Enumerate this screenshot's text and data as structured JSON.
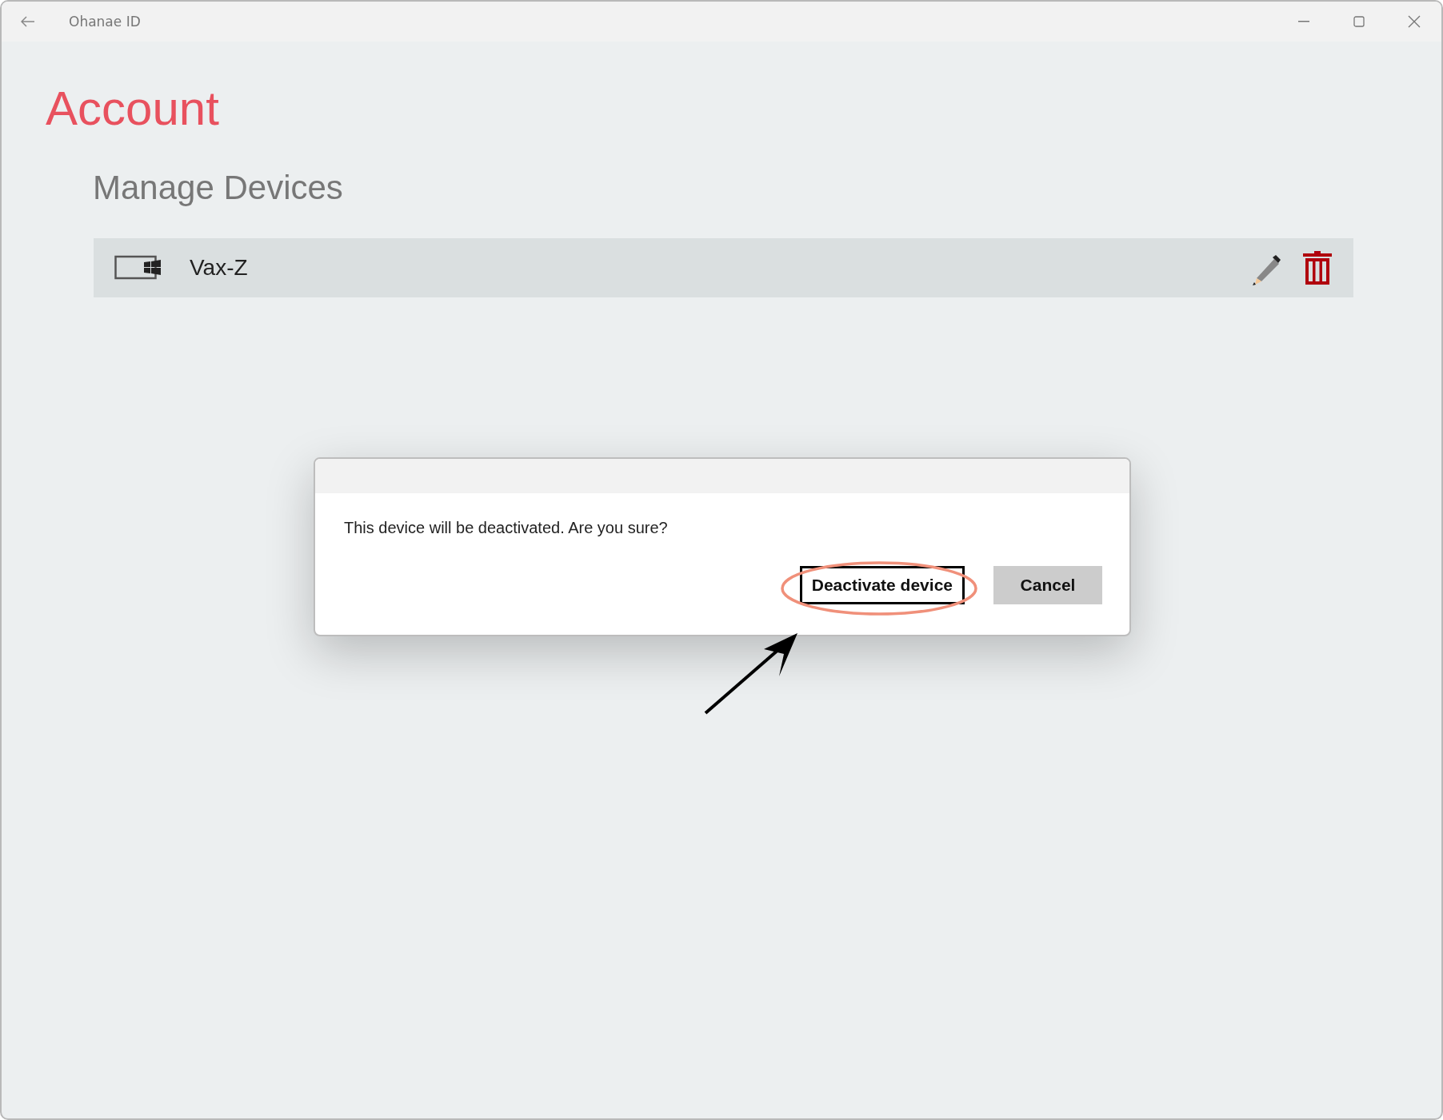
{
  "window": {
    "title": "Ohanae ID"
  },
  "page": {
    "title": "Account",
    "section_title": "Manage Devices"
  },
  "devices": [
    {
      "name": "Vax-Z"
    }
  ],
  "dialog": {
    "message": "This device will be deactivated. Are you sure?",
    "buttons": [
      {
        "label": "Deactivate device",
        "focused": true
      },
      {
        "label": "Cancel",
        "focused": false
      }
    ]
  }
}
